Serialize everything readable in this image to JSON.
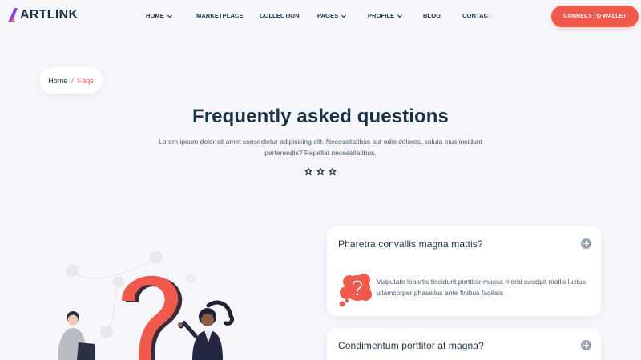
{
  "brand": {
    "name": "ARTLINK"
  },
  "nav": {
    "items": [
      {
        "label": "HOME",
        "dropdown": true
      },
      {
        "label": "MARKETPLACE",
        "dropdown": false
      },
      {
        "label": "COLLECTION",
        "dropdown": false
      },
      {
        "label": "PAGES",
        "dropdown": true
      },
      {
        "label": "PROFILE",
        "dropdown": true
      },
      {
        "label": "BLOG",
        "dropdown": false
      },
      {
        "label": "CONTACT",
        "dropdown": false
      }
    ],
    "cta_label": "CONNECT TO WALLET"
  },
  "breadcrumb": {
    "home": "Home",
    "separator": "/",
    "current": "Faqs"
  },
  "hero": {
    "title": "Frequently asked questions",
    "subtitle": "Lorem ipsum dolor sit amet consectetur adipisicing elit. Necessitatibus aut odio dolores, soluta eius incidunt perferendis? Repellat necessitatibus."
  },
  "faq": {
    "items": [
      {
        "question": "Pharetra convallis magna mattis?",
        "answer": "Vulputate lobortis tincidunt porttitor massa morbi suscipit mollis luctus ullamcorper phasellus ante finibus facilisis .",
        "expanded": true,
        "icon": "question-bubble-icon"
      },
      {
        "question": "Condimentum porttitor at magna?",
        "answer": "",
        "expanded": false,
        "icon": "plus-icon"
      }
    ]
  },
  "colors": {
    "accent": "#ef5a4c",
    "heading": "#1b3347",
    "background": "#f6f6fb",
    "toggle": "#9aa3ad"
  }
}
